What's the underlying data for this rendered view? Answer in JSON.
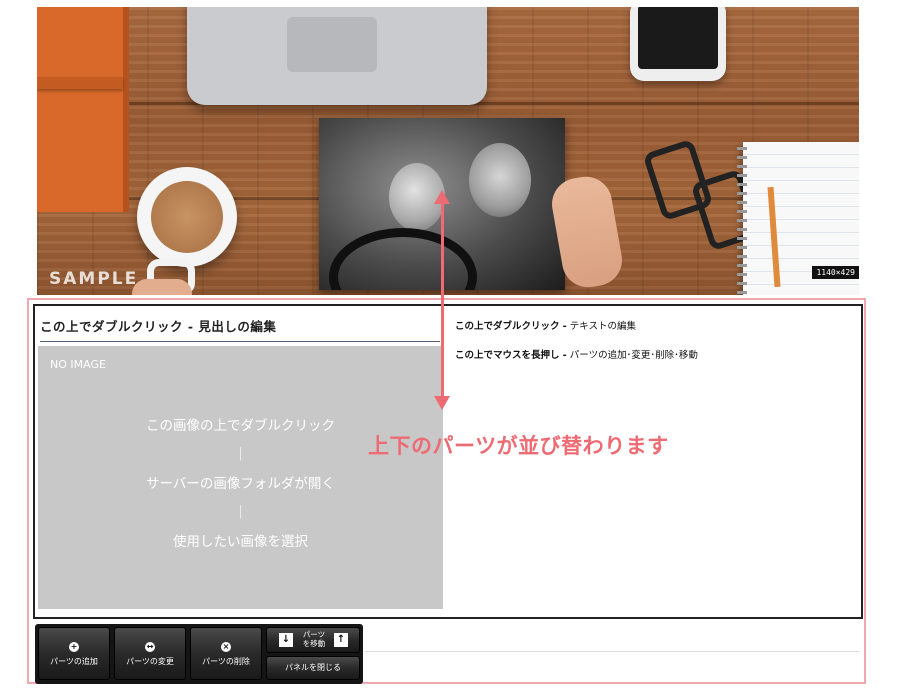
{
  "hero": {
    "watermark": "SAMPLE",
    "size_badge": "1140×429"
  },
  "panel": {
    "heading": "この上でダブルクリック - 見出しの編集",
    "placeholder": {
      "no_image": "NO IMAGE",
      "steps": [
        "この画像の上でダブルクリック",
        "｜",
        "サーバーの画像フォルダが開く",
        "｜",
        "使用したい画像を選択"
      ]
    },
    "hints": [
      {
        "strong": "この上でダブルクリック -",
        "text": " テキストの編集"
      },
      {
        "strong": "この上でマウスを長押し -",
        "text": " パーツの追加･変更･削除･移動"
      }
    ]
  },
  "annotation": {
    "message": "上下のパーツが並び替わります",
    "color": "#ee6b74"
  },
  "toolbar": {
    "add_label": "パーツの追加",
    "change_label": "パーツの変更",
    "delete_label": "パーツの削除",
    "move_label": "パーツ\nを移動",
    "close_label": "パネルを閉じる"
  },
  "colors": {
    "frame_border": "#f0a7ae",
    "placeholder_bg": "#c8c8c8",
    "toolbar_bg": "#151515"
  }
}
